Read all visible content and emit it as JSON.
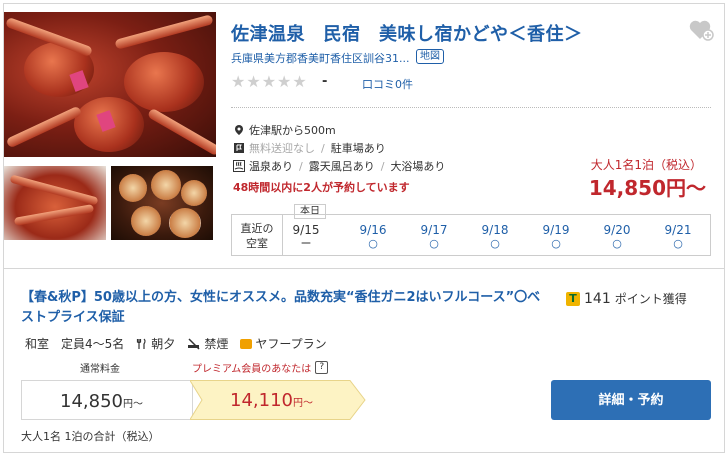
{
  "hotel": {
    "name": "佐津温泉　民宿　美味し宿かどや＜香住＞",
    "address": "兵庫県美方郡香美町香住区訓谷31...",
    "map_label": "地図",
    "rating_stars": 0,
    "rating_value": "-",
    "reviews_label": "口コミ0件"
  },
  "features": {
    "access": "佐津駅から500m",
    "pickup": "無料送迎なし",
    "parking": "駐車場あり",
    "onsen": "温泉あり",
    "rotenburo": "露天風呂あり",
    "bath": "大浴場あり",
    "hurry": "48時間以内に2人が予約しています"
  },
  "price": {
    "label": "大人1名1泊（税込）",
    "amount": "14,850円〜"
  },
  "calendar": {
    "label_line1": "直近の",
    "label_line2": "空室",
    "today_tag": "本日",
    "days": [
      {
        "date": "9/15",
        "mark": "ー",
        "today": true
      },
      {
        "date": "9/16",
        "mark": "○",
        "today": false
      },
      {
        "date": "9/17",
        "mark": "○",
        "today": false
      },
      {
        "date": "9/18",
        "mark": "○",
        "today": false
      },
      {
        "date": "9/19",
        "mark": "○",
        "today": false
      },
      {
        "date": "9/20",
        "mark": "○",
        "today": false
      },
      {
        "date": "9/21",
        "mark": "○",
        "today": false
      }
    ]
  },
  "plan": {
    "title": "【春&秋P】50歳以上の方、女性にオススメ。品数充実“香住ガニ2はいフルコース”〇ベストプライス保証",
    "points_icon": "T",
    "points_value": "141",
    "points_suffix": "ポイント獲得",
    "room_type": "和室",
    "capacity": "定員4〜5名",
    "meals": "朝夕",
    "smoking": "禁煙",
    "yahoo_plan": "ヤフープラン",
    "regular_label": "通常料金",
    "premium_label": "プレミアム会員のあなたは",
    "help": "?",
    "regular_price": "14,850",
    "regular_unit": "円〜",
    "premium_price": "14,110",
    "premium_unit": "円〜",
    "total_note": "大人1名 1泊の合計（税込）",
    "detail_button": "詳細・予約"
  },
  "colors": {
    "link_blue": "#1f5fa8",
    "price_red": "#c0272d",
    "button_blue": "#2d6fb5",
    "premium_bg": "#fdf3c4"
  }
}
